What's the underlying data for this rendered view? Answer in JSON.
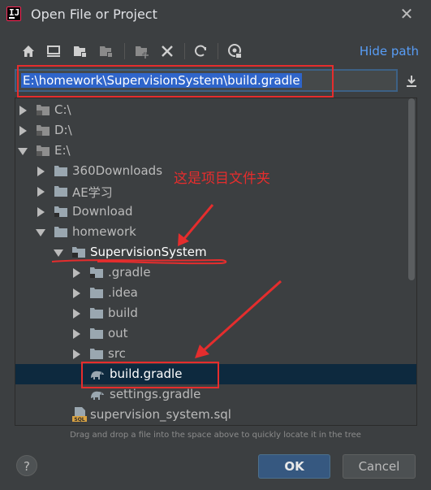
{
  "window": {
    "title": "Open File or Project",
    "close_icon": "close-icon"
  },
  "toolbar": {
    "buttons": [
      "home-icon",
      "desktop-icon",
      "project-icon",
      "module-icon",
      "new-folder-icon",
      "delete-icon",
      "refresh-icon",
      "show-hidden-icon"
    ],
    "hide_path_label": "Hide path"
  },
  "path": {
    "value": "E:\\homework\\SupervisionSystem\\build.gradle",
    "download_icon": "download-icon"
  },
  "tree": {
    "items": [
      {
        "label": "C:\\",
        "type": "drive",
        "expanded": false
      },
      {
        "label": "D:\\",
        "type": "drive",
        "expanded": false
      },
      {
        "label": "E:\\",
        "type": "drive",
        "expanded": true
      },
      {
        "label": "360Downloads",
        "type": "folder",
        "expanded": false
      },
      {
        "label": "AE学习",
        "type": "folder",
        "expanded": false
      },
      {
        "label": "Download",
        "type": "folder-special",
        "expanded": false
      },
      {
        "label": "homework",
        "type": "folder",
        "expanded": true
      },
      {
        "label": "SupervisionSystem",
        "type": "folder-module",
        "expanded": true
      },
      {
        "label": ".gradle",
        "type": "folder-special",
        "expanded": false
      },
      {
        "label": ".idea",
        "type": "folder",
        "expanded": false
      },
      {
        "label": "build",
        "type": "folder",
        "expanded": false
      },
      {
        "label": "out",
        "type": "folder",
        "expanded": false
      },
      {
        "label": "src",
        "type": "folder",
        "expanded": false
      },
      {
        "label": "build.gradle",
        "type": "gradle-file",
        "selected": true
      },
      {
        "label": "settings.gradle",
        "type": "gradle-file"
      },
      {
        "label": "supervision_system.sql",
        "type": "sql-file"
      }
    ]
  },
  "annotation": {
    "text": "这是项目文件夹",
    "color": "#e52d2d"
  },
  "footer": {
    "hint": "Drag and drop a file into the space above to quickly locate it in the tree",
    "help_label": "?",
    "ok_label": "OK",
    "cancel_label": "Cancel"
  },
  "colors": {
    "background": "#3c3f41",
    "accent": "#589df6",
    "selection": "#0d293e",
    "ok_button": "#365880"
  }
}
